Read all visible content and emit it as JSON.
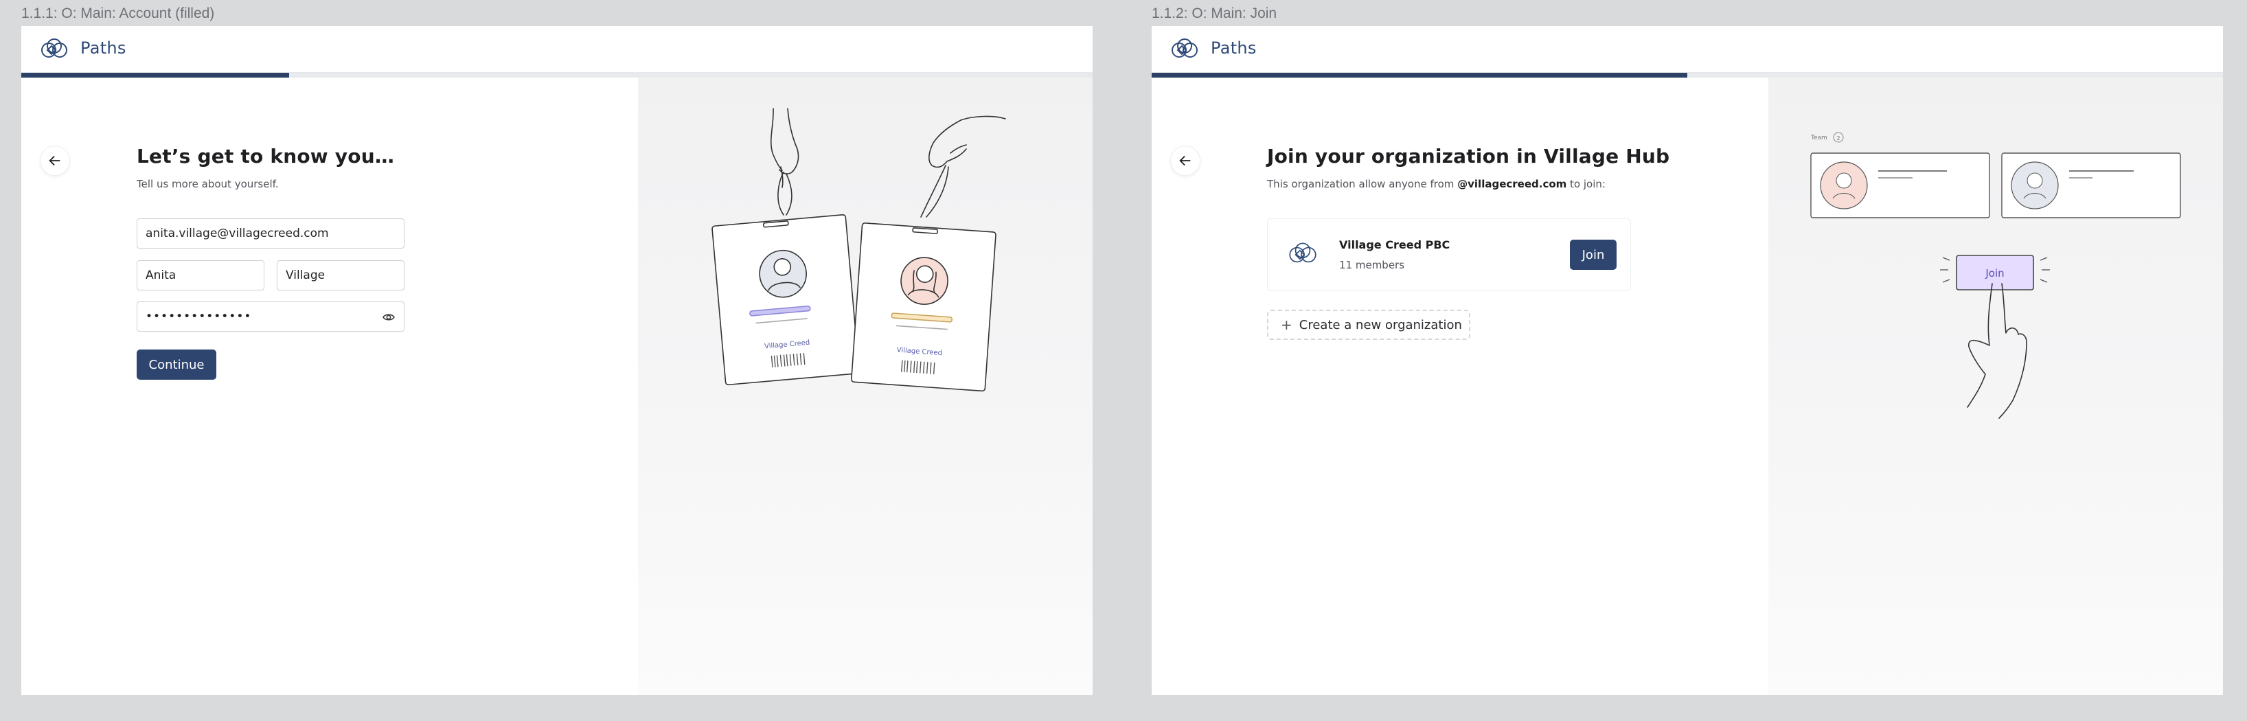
{
  "frames": [
    {
      "label": "1.1.1: O: Main: Account (filled)",
      "brand": {
        "name": "Paths",
        "logo_icon": "triple-hex-logo-icon"
      },
      "progress": 0.25,
      "back_icon": "arrow-left-icon",
      "title": "Let’s get to know you…",
      "subtitle": "Tell us more about yourself.",
      "email": "anita.village@villagecreed.com",
      "first_name": "Anita",
      "last_name": "Village",
      "password_masked": "••••••••••••••",
      "password_toggle_icon": "eye-icon",
      "continue_label": "Continue",
      "illustration": {
        "badge_left_caption": "Village Creed",
        "badge_right_caption": "Village Creed"
      }
    },
    {
      "label": "1.1.2: O: Main: Join",
      "brand": {
        "name": "Paths",
        "logo_icon": "triple-hex-logo-icon"
      },
      "progress": 0.5,
      "back_icon": "arrow-left-icon",
      "title": "Join your organization in Village Hub",
      "subtitle_prefix": "This organization allow anyone from ",
      "subtitle_domain": "@villagecreed.com",
      "subtitle_suffix": " to join:",
      "org": {
        "name": "Village Creed PBC",
        "members": "11 members",
        "join_label": "Join"
      },
      "create_label": "Create a new organization",
      "create_icon": "plus-icon",
      "illustration": {
        "team_label": "Team",
        "team_count": "2",
        "join_button": "Join"
      }
    }
  ],
  "colors": {
    "primary": "#2e4570",
    "brand_text": "#2f4a78",
    "progress": "#2b4166",
    "join_highlight": "#e6dcff"
  }
}
